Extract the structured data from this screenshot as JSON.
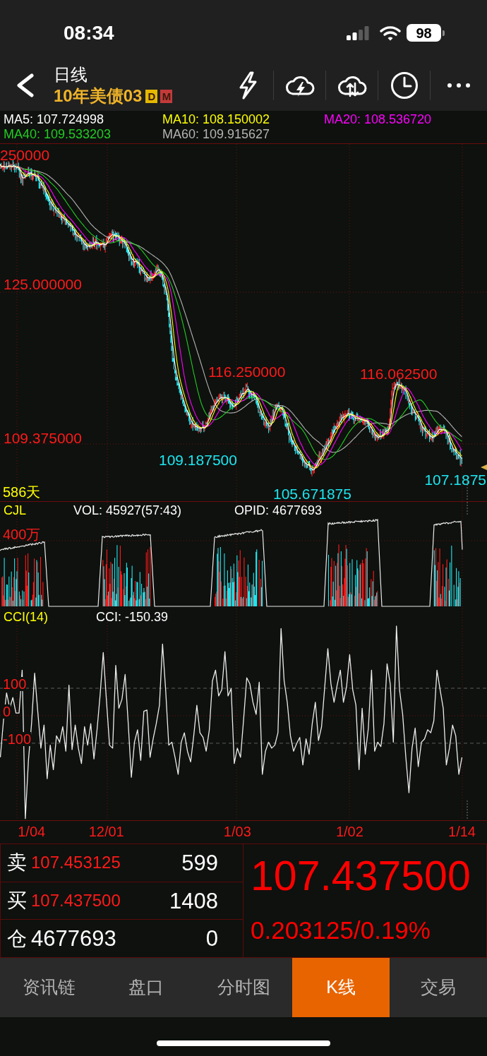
{
  "status_bar": {
    "time": "08:34",
    "battery": "98"
  },
  "nav": {
    "title": "日线",
    "subtitle": "10年美债03",
    "badges": [
      {
        "text": "D",
        "color": "#e6b800"
      },
      {
        "text": "M",
        "color": "#c43a3a"
      }
    ]
  },
  "ma_legend": [
    {
      "label": "MA5: 107.724998",
      "color": "#ffffff"
    },
    {
      "label": "MA10: 108.150002",
      "color": "#ffff00"
    },
    {
      "label": "MA20: 108.536720",
      "color": "#ff00ff"
    },
    {
      "label": "MA40: 109.533203",
      "color": "#22cc22"
    },
    {
      "label": "MA60: 109.915627",
      "color": "#b4b4b4"
    }
  ],
  "price_chart": {
    "axis_labels": [
      "250000",
      "125.000000",
      "109.375000"
    ],
    "annotations": [
      {
        "text": "116.250000",
        "kind": "high"
      },
      {
        "text": "116.062500",
        "kind": "high"
      },
      {
        "text": "109.187500",
        "kind": "low"
      },
      {
        "text": "107.1875",
        "kind": "low"
      },
      {
        "text": "105.671875",
        "kind": "low"
      }
    ],
    "span": "586天"
  },
  "volume_panel": {
    "name": "CJL",
    "readings": [
      "VOL: 45927(57:43)",
      "OPID: 4677693"
    ],
    "axis_label": "400万"
  },
  "cci_panel": {
    "name": "CCI(14)",
    "reading": "CCI: -150.39",
    "chart_data": {
      "type": "line",
      "grid": true,
      "ylim": [
        -380,
        390
      ],
      "yticks": [
        {
          "value": 100,
          "label": "100"
        },
        {
          "value": 0,
          "label": "0"
        },
        {
          "value": -100,
          "label": "-100"
        }
      ],
      "categories": [
        null,
        null,
        null,
        null,
        null,
        null,
        null,
        null,
        null,
        null,
        "1/04",
        null,
        null,
        null,
        null,
        null,
        null,
        null,
        null,
        null,
        null,
        null,
        null,
        null,
        null,
        null,
        null,
        null,
        null,
        null,
        null,
        null,
        null,
        null,
        "12/01",
        null,
        null,
        null,
        null,
        null,
        null,
        null,
        null,
        null,
        null,
        null,
        null,
        null,
        null,
        null,
        null,
        null,
        null,
        null,
        null,
        null,
        null,
        null,
        null,
        null,
        null,
        null,
        null,
        null,
        null,
        null,
        null,
        null,
        null,
        null,
        null,
        null,
        null,
        null,
        null,
        null,
        "1/03",
        null,
        null,
        null,
        null,
        null,
        null,
        null,
        null,
        null,
        null,
        null,
        null,
        null,
        null,
        null,
        null,
        null,
        null,
        null,
        null,
        null,
        null,
        null,
        null,
        null,
        null,
        null,
        null,
        null,
        null,
        null,
        null,
        null,
        null,
        null,
        "1/02",
        null,
        null,
        null,
        null,
        null,
        null,
        null,
        null,
        null,
        null,
        null,
        null,
        null,
        null,
        null,
        null,
        null,
        null,
        null,
        null,
        null,
        null,
        null,
        null,
        null,
        null,
        null,
        null,
        null,
        null,
        null,
        null,
        null,
        null,
        null,
        "1/14"
      ],
      "values": [
        -151,
        -18,
        83,
        27,
        66,
        10,
        10,
        166,
        -374,
        -162,
        -29,
        155,
        16,
        -118,
        -34,
        -229,
        -107,
        -196,
        -73,
        -96,
        -40,
        -129,
        111,
        -123,
        -34,
        -118,
        -174,
        -40,
        -107,
        -29,
        -157,
        -51,
        77,
        230,
        60,
        -107,
        -118,
        183,
        27,
        60,
        150,
        -29,
        -224,
        -96,
        -51,
        -162,
        16,
        21,
        -151,
        -84,
        -29,
        38,
        261,
        94,
        -107,
        -96,
        -151,
        -213,
        -96,
        -62,
        -129,
        -168,
        -73,
        38,
        -62,
        -79,
        -129,
        -51,
        127,
        166,
        72,
        94,
        233,
        72,
        99,
        -174,
        -118,
        -151,
        -12,
        138,
        116,
        49,
        5,
        122,
        -213,
        -129,
        -96,
        -118,
        -107,
        -62,
        317,
        127,
        49,
        -73,
        -129,
        -101,
        -79,
        -179,
        -84,
        -140,
        -29,
        49,
        -90,
        -40,
        105,
        244,
        116,
        49,
        111,
        166,
        49,
        105,
        222,
        94,
        38,
        -196,
        27,
        -140,
        -45,
        166,
        -129,
        -96,
        -112,
        -29,
        189,
        116,
        -96,
        326,
        94,
        5,
        -151,
        -280,
        -118,
        -45,
        -185,
        -96,
        -84,
        -51,
        -62,
        -18,
        166,
        94,
        27,
        -179,
        -118,
        -34,
        -73,
        -213,
        -151
      ]
    }
  },
  "order_book": [
    {
      "label": "卖",
      "value": "107.453125",
      "quantity": "599",
      "kind": "quote"
    },
    {
      "label": "买",
      "value": "107.437500",
      "quantity": "1408",
      "kind": "quote"
    },
    {
      "label": "仓",
      "value": "4677693",
      "quantity": "0",
      "kind": "position"
    }
  ],
  "last_price": {
    "price": "107.437500",
    "change": "0.203125/0.19%"
  },
  "tabs": [
    {
      "label": "资讯链",
      "selected": false
    },
    {
      "label": "盘口",
      "selected": false
    },
    {
      "label": "分时图",
      "selected": false
    },
    {
      "label": "K线",
      "selected": true
    },
    {
      "label": "交易",
      "selected": false
    }
  ]
}
